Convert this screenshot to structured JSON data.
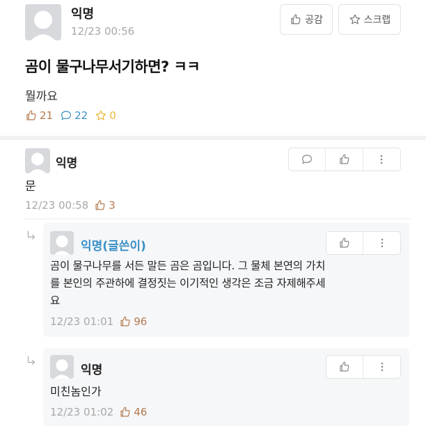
{
  "post": {
    "author": "익명",
    "time": "12/23 00:56",
    "like_button": "공감",
    "scrap_button": "스크랩",
    "title": "곰이 물구나무서기하면? ㅋㅋ",
    "body": "뭘까요",
    "likes": "21",
    "comments": "22",
    "scraps": "0"
  },
  "comments": [
    {
      "author": "익명",
      "text": "문",
      "time": "12/23 00:58",
      "likes": "3"
    }
  ],
  "replies": [
    {
      "author": "익명(글쓴이)",
      "text_line1": "곰이 물구나무를 서든 말든 곰은 곰입니다. 그 물체 본연의 가치",
      "text_line2": "를 본인의 주관하에 결정짓는 이기적인 생각은 조금 자제해주세",
      "text_line3": "요",
      "time": "12/23 01:01",
      "likes": "96"
    },
    {
      "author": "익명",
      "text": "미친놈인가",
      "time": "12/23 01:02",
      "likes": "46"
    }
  ],
  "icons": [
    "thumbs-up-icon",
    "comment-icon",
    "star-icon",
    "more-vertical-icon",
    "reply-arrow-icon",
    "avatar-icon"
  ],
  "colors": {
    "like": "#b47a4f",
    "comment": "#3a90c6",
    "scrap": "#e8b838",
    "op_author": "#3a90c6"
  }
}
